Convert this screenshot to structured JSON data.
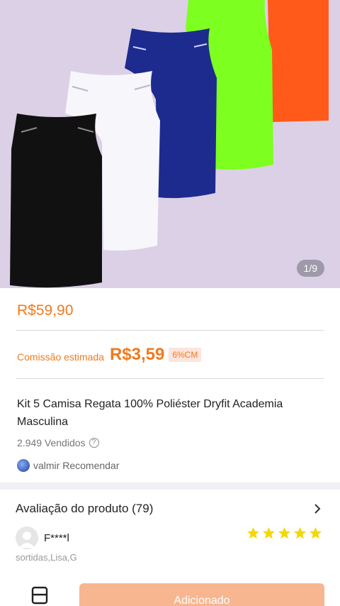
{
  "gallery": {
    "counter": "1/9"
  },
  "product": {
    "price": "R$59,90",
    "commission_label": "Comissão estimada",
    "commission_value": "R$3,59",
    "commission_badge": "6%CM",
    "title": "Kit 5 Camisa Regata 100% Poliéster Dryfit Academia Masculina",
    "sold": "2.949 Vendidos",
    "recommend": "valmir Recomendar"
  },
  "reviews": {
    "heading": "Avaliação do produto (79)",
    "first": {
      "name": "F****l",
      "rating": 5,
      "variant": "sortidas,Lisa,G"
    }
  },
  "bottom": {
    "add_button": "Adicionado"
  },
  "colors": {
    "accent": "#f07a1e",
    "button": "#f7b690",
    "star": "#f5d800"
  }
}
